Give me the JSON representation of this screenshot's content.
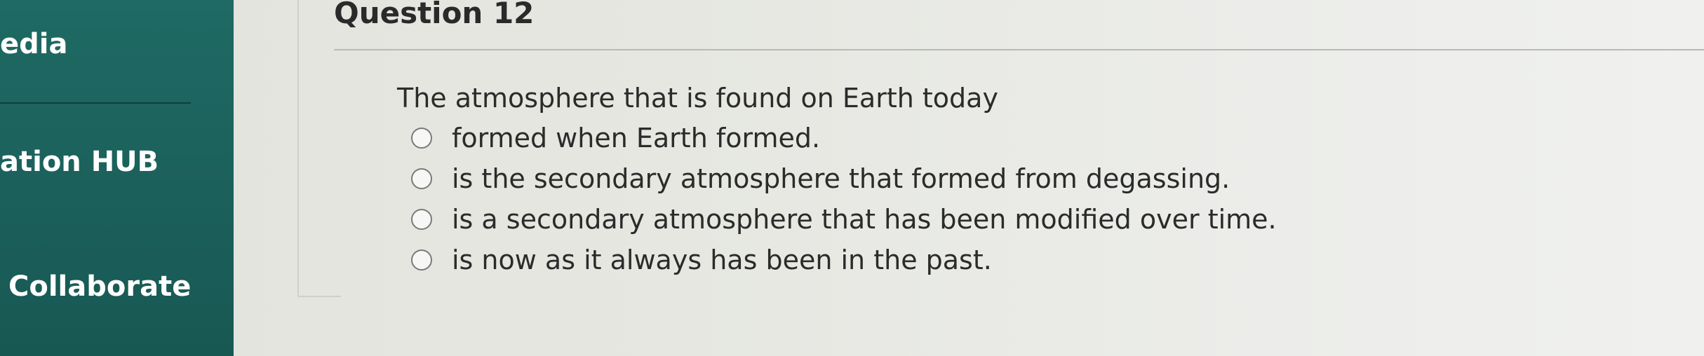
{
  "sidebar": {
    "items": [
      {
        "label": "edia"
      },
      {
        "label": "ation HUB"
      },
      {
        "label": "Collaborate"
      }
    ]
  },
  "question": {
    "title": "Question 12",
    "prompt": "The atmosphere that is found on Earth today",
    "options": [
      {
        "label": "formed when Earth formed."
      },
      {
        "label": "is the secondary atmosphere that formed from degassing."
      },
      {
        "label": "is a secondary atmosphere that has been modified over time."
      },
      {
        "label": "is now as it always has been in the past."
      }
    ]
  },
  "colors": {
    "sidebar": "#1d6560",
    "background": "#e6e7e1",
    "text": "#2b2b2b"
  }
}
